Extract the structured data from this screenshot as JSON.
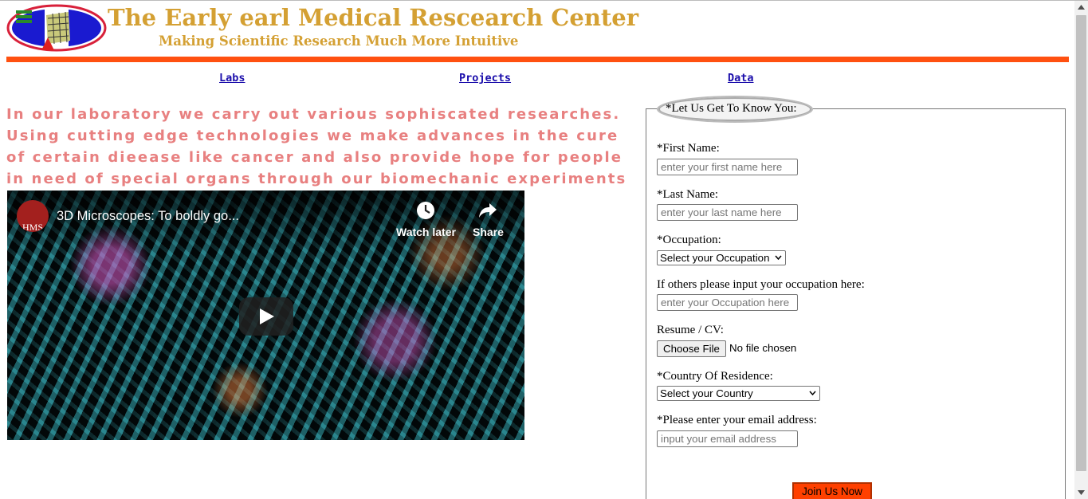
{
  "header": {
    "title": "The Early earl Medical Rescearch Center",
    "subtitle": "Making Scientific Research Much More Intuitive",
    "accent_color": "#d4a033",
    "rule_color": "#ff5010"
  },
  "nav": {
    "items": [
      {
        "label": "Labs"
      },
      {
        "label": "Projects"
      },
      {
        "label": "Data"
      }
    ]
  },
  "intro": {
    "text": "In our laboratory we carry out various sophiscated researches. Using cutting edge technologies we make advances in the cure of certain dieease like cancer and also provide hope for people in need of special organs through our biomechanic experiments and projects."
  },
  "video": {
    "channel_badge": "HMS",
    "title": "3D Microscopes: To boldly go...",
    "watch_later_label": "Watch later",
    "share_label": "Share",
    "icons": [
      "clock-icon",
      "share-icon",
      "play-icon"
    ]
  },
  "form": {
    "legend": "*Let Us Get To Know You:",
    "first_name": {
      "label": "*First Name:",
      "placeholder": "enter your first name here"
    },
    "last_name": {
      "label": "*Last Name:",
      "placeholder": "enter your last name here"
    },
    "occupation": {
      "label": "*Occupation:",
      "selected": "Select your Occupation"
    },
    "other_occupation": {
      "label": "If others please input your occupation here:",
      "placeholder": "enter your Occupation here"
    },
    "resume": {
      "label": "Resume / CV:",
      "button": "Choose File",
      "status": "No file chosen"
    },
    "country": {
      "label": "*Country Of Residence:",
      "selected": "Select your Country"
    },
    "email": {
      "label": "*Please enter your email address:",
      "placeholder": "input your email address"
    },
    "submit_label": "Join Us Now",
    "submit_color": "#ff4000"
  }
}
